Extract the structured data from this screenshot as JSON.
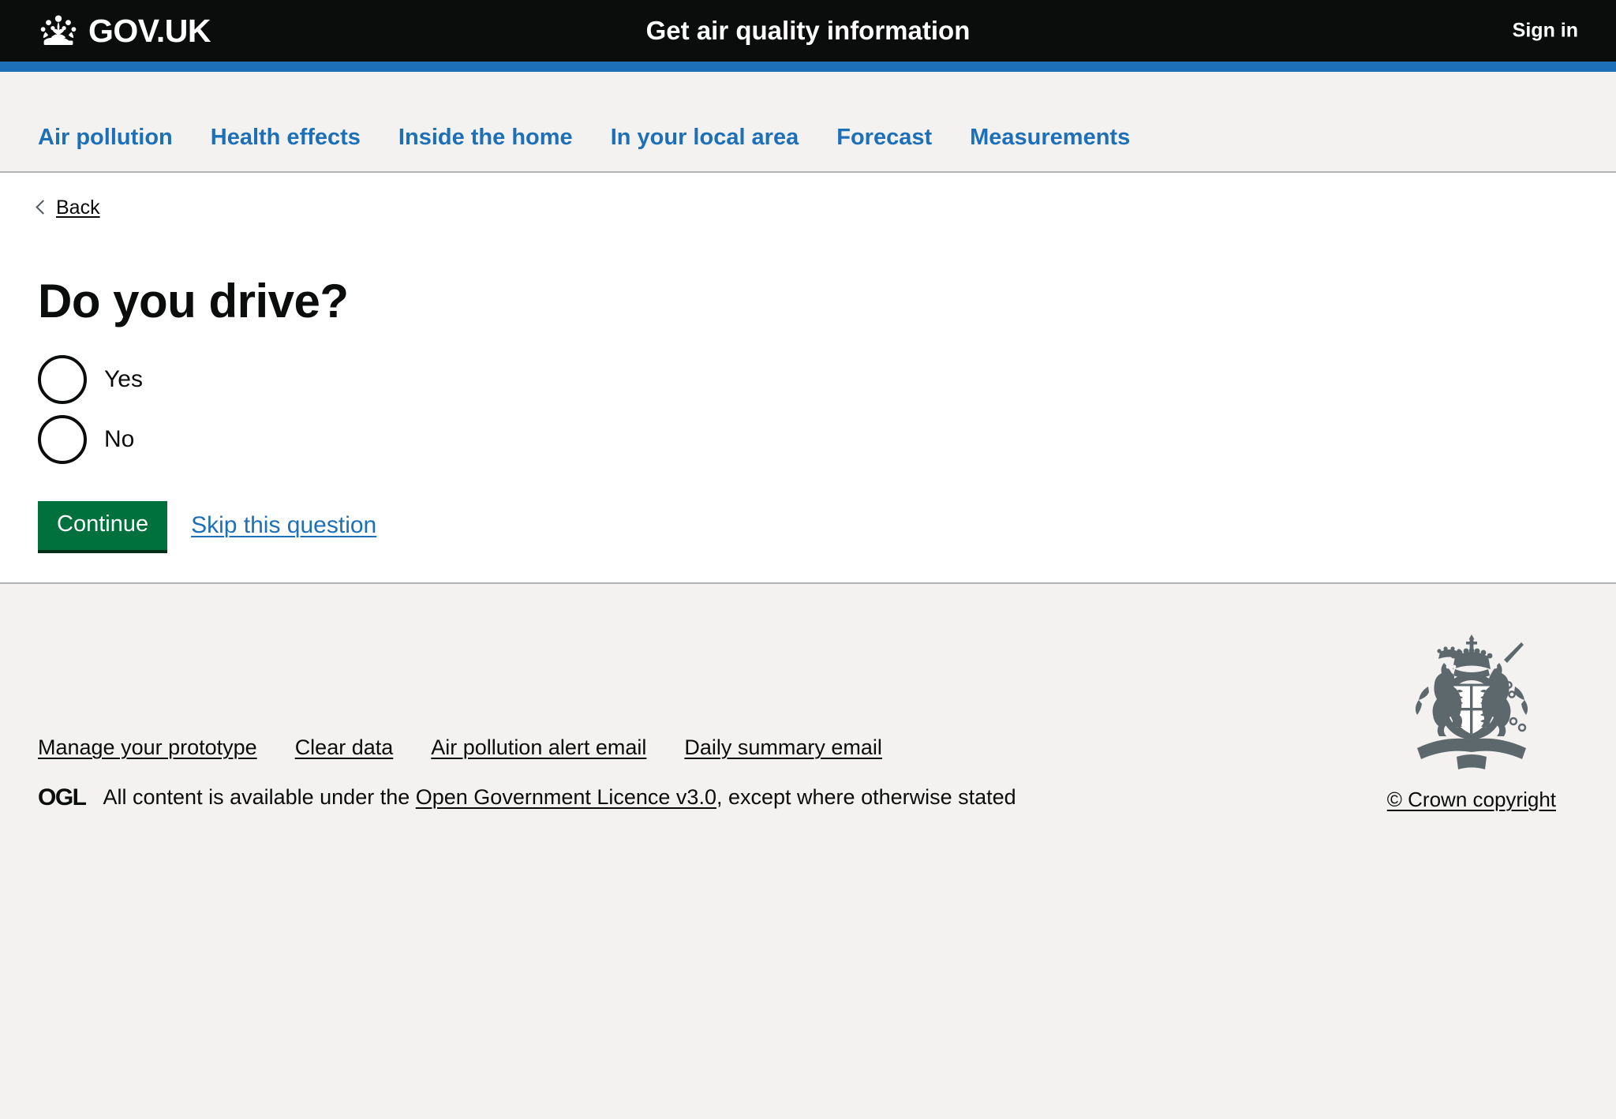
{
  "header": {
    "logo_text": "GOV.UK",
    "logo_icon": "crown-icon",
    "service_name": "Get air quality information",
    "sign_in_label": "Sign in",
    "background_color": "#0b0c0c",
    "accent_color": "#1d70b8"
  },
  "nav": {
    "items": [
      {
        "label": "Air pollution"
      },
      {
        "label": "Health effects"
      },
      {
        "label": "Inside the home"
      },
      {
        "label": "In your local area"
      },
      {
        "label": "Forecast"
      },
      {
        "label": "Measurements"
      }
    ],
    "link_color": "#1d70b8",
    "background_color": "#f3f2f1"
  },
  "main": {
    "back_label": "Back",
    "back_icon": "chevron-left-icon",
    "heading": "Do you drive?",
    "radios": [
      {
        "label": "Yes",
        "checked": false
      },
      {
        "label": "No",
        "checked": false
      }
    ],
    "continue_label": "Continue",
    "skip_label": "Skip this question",
    "button_color": "#00703c"
  },
  "footer": {
    "links": [
      {
        "label": "Manage your prototype"
      },
      {
        "label": "Clear data"
      },
      {
        "label": "Air pollution alert email"
      },
      {
        "label": "Daily summary email"
      }
    ],
    "ogl_logo_text": "OGL",
    "licence_prefix": "All content is available under the ",
    "licence_link": "Open Government Licence v3.0",
    "licence_suffix": ", except where otherwise stated",
    "crown_copyright_label": "© Crown copyright",
    "crest_icon": "royal-arms-crest-icon",
    "background_color": "#f3f2f1"
  }
}
